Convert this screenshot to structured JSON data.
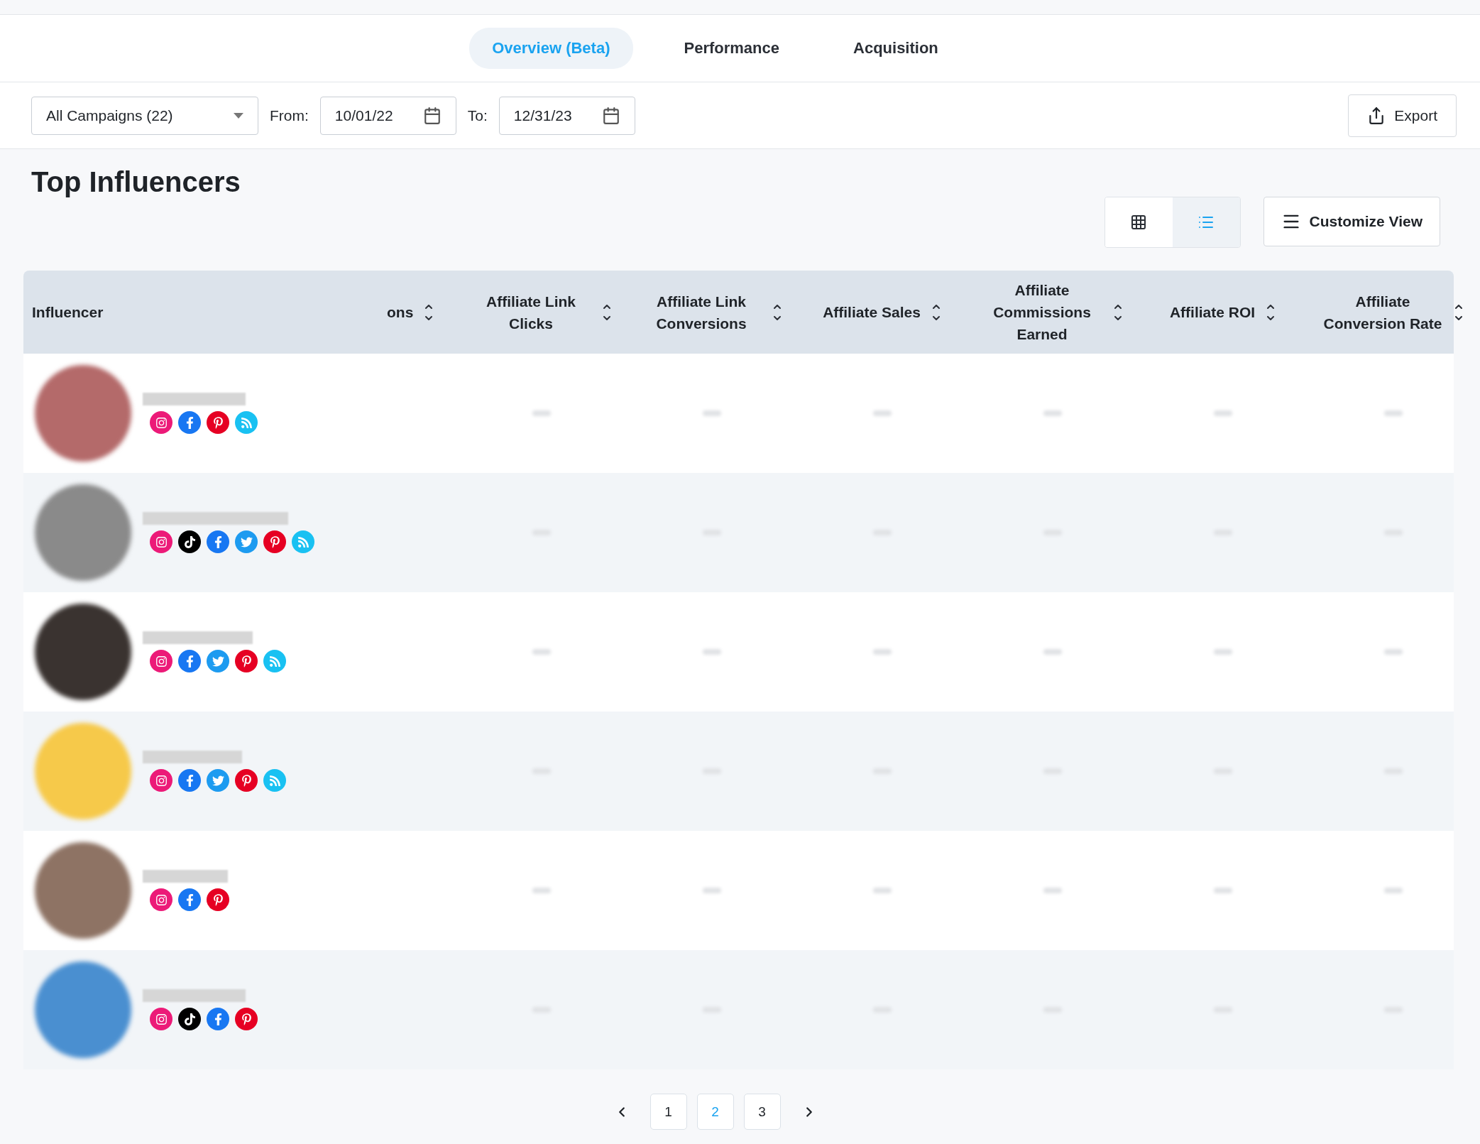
{
  "tabs": [
    {
      "label": "Overview (Beta)",
      "selected": true
    },
    {
      "label": "Performance",
      "selected": false
    },
    {
      "label": "Acquisition",
      "selected": false
    }
  ],
  "filters": {
    "campaign": "All Campaigns (22)",
    "from_label": "From:",
    "from_value": "10/01/22",
    "to_label": "To:",
    "to_value": "12/31/23",
    "export": "Export"
  },
  "section_title": "Top Influencers",
  "view_toggle": [
    {
      "kind": "grid",
      "selected": false
    },
    {
      "kind": "list",
      "selected": true
    }
  ],
  "customize_button": "Customize View",
  "table": {
    "columns": [
      {
        "label": "Influencer",
        "sortable": false
      },
      {
        "label": "ons",
        "sortable": true
      },
      {
        "label": "Affiliate Link Clicks",
        "sortable": true
      },
      {
        "label": "Affiliate Link Conversions",
        "sortable": true
      },
      {
        "label": "Affiliate Sales",
        "sortable": true
      },
      {
        "label": "Affiliate Commissions Earned",
        "sortable": true
      },
      {
        "label": "Affiliate ROI",
        "sortable": true
      },
      {
        "label": "Affiliate Conversion Rate",
        "sortable": true
      }
    ],
    "rows": [
      {
        "color": "#b46a6a",
        "socials": [
          {
            "kind": "instagram"
          },
          {
            "kind": "facebook"
          },
          {
            "kind": "pinterest"
          },
          {
            "kind": "rss"
          }
        ]
      },
      {
        "color": "#8a8a8a",
        "socials": [
          {
            "kind": "instagram"
          },
          {
            "kind": "tiktok"
          },
          {
            "kind": "facebook"
          },
          {
            "kind": "twitter"
          },
          {
            "kind": "pinterest"
          },
          {
            "kind": "rss"
          }
        ]
      },
      {
        "color": "#3a3330",
        "socials": [
          {
            "kind": "instagram"
          },
          {
            "kind": "facebook"
          },
          {
            "kind": "twitter"
          },
          {
            "kind": "pinterest"
          },
          {
            "kind": "rss"
          }
        ]
      },
      {
        "color": "#f6c94a",
        "socials": [
          {
            "kind": "instagram"
          },
          {
            "kind": "facebook"
          },
          {
            "kind": "twitter"
          },
          {
            "kind": "pinterest"
          },
          {
            "kind": "rss"
          }
        ]
      },
      {
        "color": "#8e7364",
        "socials": [
          {
            "kind": "instagram"
          },
          {
            "kind": "facebook"
          },
          {
            "kind": "pinterest"
          }
        ]
      },
      {
        "color": "#4a8fd0",
        "socials": [
          {
            "kind": "instagram"
          },
          {
            "kind": "tiktok"
          },
          {
            "kind": "facebook"
          },
          {
            "kind": "pinterest"
          }
        ]
      }
    ]
  },
  "pagination": [
    {
      "label": "1",
      "selected": false
    },
    {
      "label": "2",
      "selected": true
    },
    {
      "label": "3",
      "selected": false
    }
  ]
}
